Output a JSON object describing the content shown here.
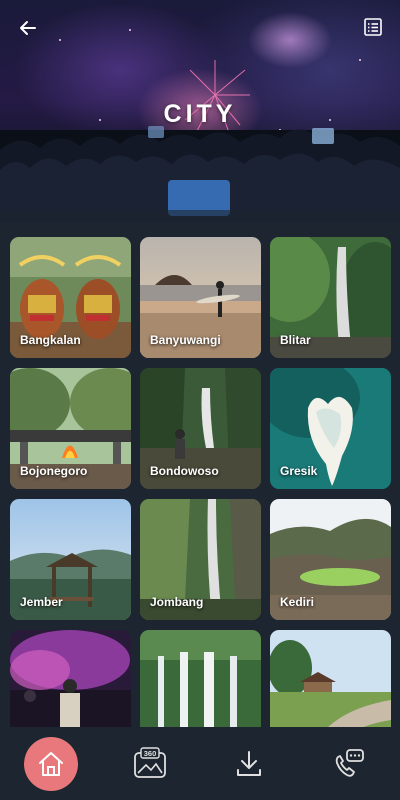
{
  "header": {
    "title": "CITY",
    "back_icon": "arrow-left-icon",
    "list_icon": "list-view-icon"
  },
  "cities": [
    {
      "name": "Bangkalan"
    },
    {
      "name": "Banyuwangi"
    },
    {
      "name": "Blitar"
    },
    {
      "name": "Bojonegoro"
    },
    {
      "name": "Bondowoso"
    },
    {
      "name": "Gresik"
    },
    {
      "name": "Jember"
    },
    {
      "name": "Jombang"
    },
    {
      "name": "Kediri"
    },
    {
      "name": ""
    },
    {
      "name": ""
    },
    {
      "name": ""
    }
  ],
  "bottom_nav": {
    "items": [
      {
        "icon": "home-icon",
        "active": true
      },
      {
        "icon": "panorama-360-icon",
        "label": "360"
      },
      {
        "icon": "download-icon"
      },
      {
        "icon": "phone-chat-icon"
      }
    ],
    "active_color": "#e8787c"
  },
  "colors": {
    "background": "#1c2530",
    "accent": "#e8787c"
  }
}
